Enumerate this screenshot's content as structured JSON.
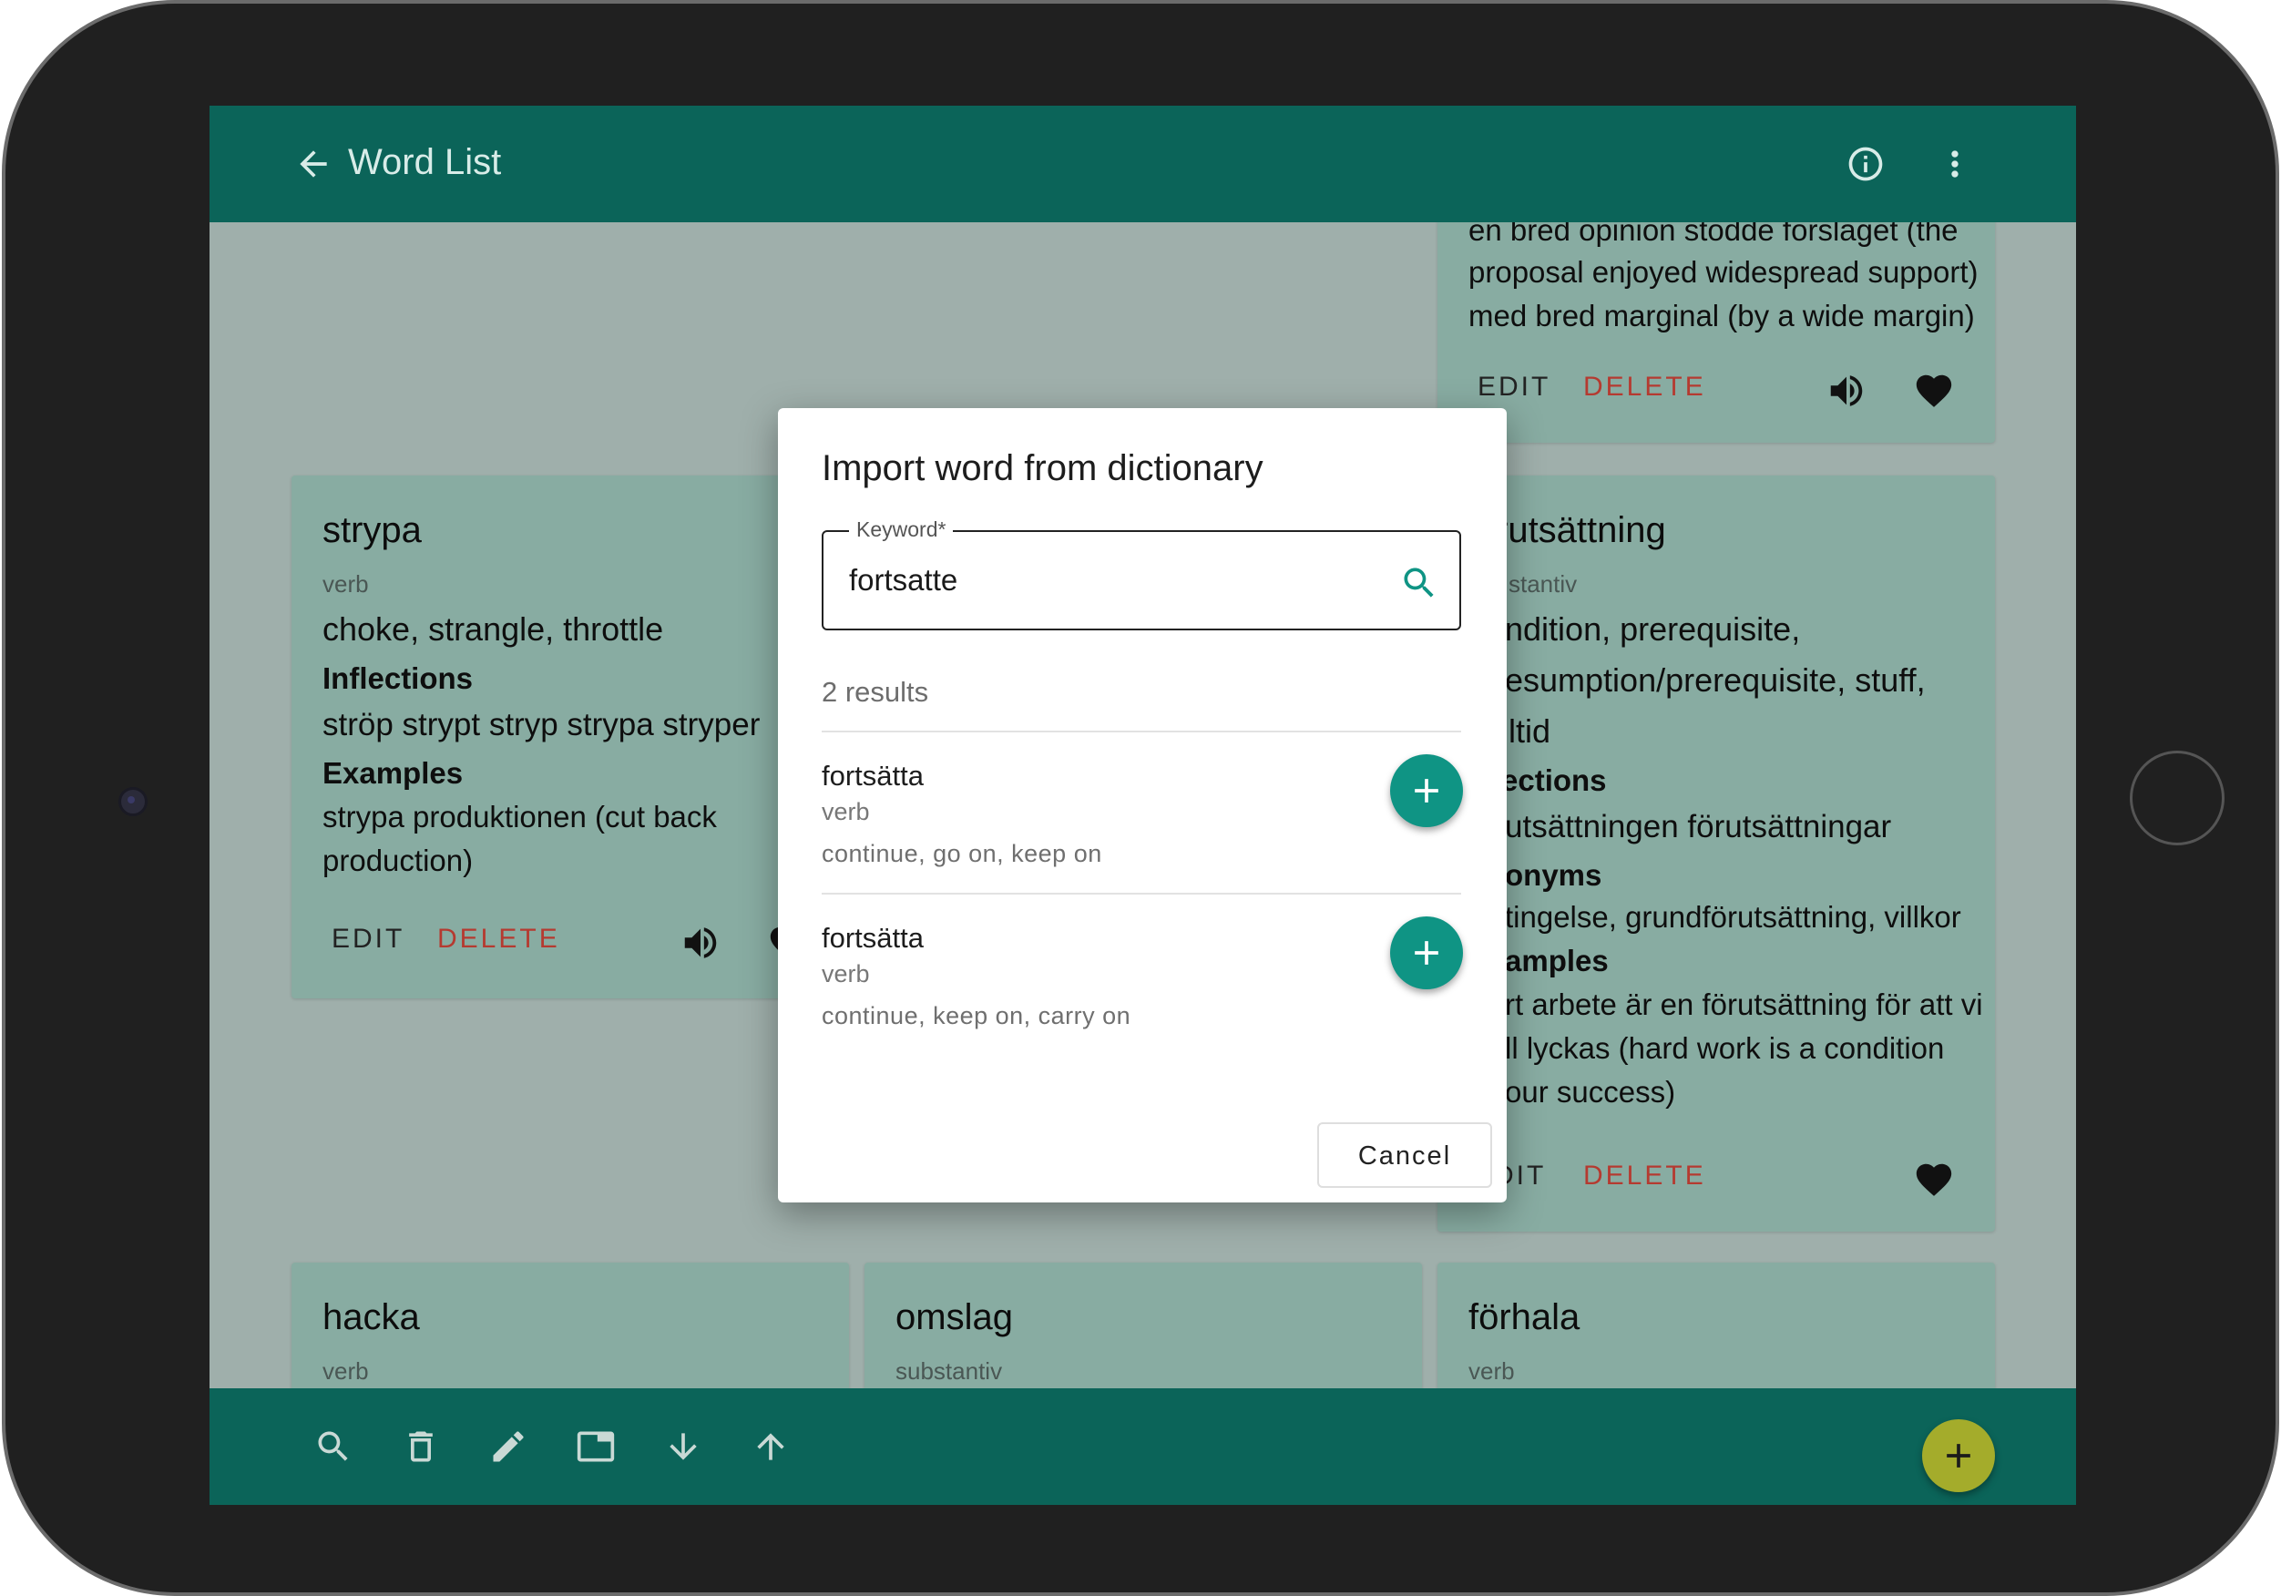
{
  "app": {
    "title": "Word List",
    "back_icon": "arrow-left-icon",
    "info_icon": "info-icon",
    "more_icon": "more-vert-icon",
    "header_color": "#0b6459",
    "fab_color": "#a4ac2b",
    "accent_color": "#0f9484"
  },
  "cards": {
    "top_right": {
      "line0": "en bred opinion stödde förslaget (the",
      "line1": "proposal enjoyed widespread support)",
      "line2": "med bred marginal (by a wide margin)",
      "edit": "EDIT",
      "delete": "DELETE"
    },
    "strypa": {
      "word": "strypa",
      "pos": "verb",
      "translation": "choke, strangle, throttle",
      "inflections_label": "Inflections",
      "inflections": "ströp strypt stryp strypa stryper",
      "examples_label": "Examples",
      "example1": "strypa produktionen (cut back",
      "example2": "production)",
      "edit": "EDIT",
      "delete": "DELETE"
    },
    "forutsattning": {
      "word": "förutsättning",
      "word_visible": "rutsättning",
      "pos_visible": "stantiv",
      "line1": "ndition, prerequisite,",
      "line2": "esumption/prerequisite, stuff,",
      "line3": "ltid",
      "inflections_label": "ections",
      "inflections": "utsättningen förutsättningar",
      "synonyms_label": "onyms",
      "synonyms": "tingelse, grundförutsättning, villkor",
      "examples_label": "amples",
      "example1": "rt arbete är en förutsättning för att vi",
      "example2": "ll lyckas (hard work is a condition",
      "example3": "our success)",
      "edit": "DIT",
      "delete": "DELETE"
    },
    "hacka": {
      "word": "hacka",
      "pos": "verb"
    },
    "omslag": {
      "word": "omslag",
      "pos": "substantiv"
    },
    "forhala": {
      "word": "förhala",
      "pos": "verb"
    }
  },
  "dialog": {
    "title": "Import word from dictionary",
    "keyword_label": "Keyword*",
    "keyword_value": "fortsatte",
    "results_count": "2 results",
    "results": [
      {
        "word": "fortsätta",
        "pos": "verb",
        "definition": "continue, go on, keep on"
      },
      {
        "word": "fortsätta",
        "pos": "verb",
        "definition": "continue, keep on, carry on"
      }
    ],
    "cancel_label": "Cancel"
  },
  "bottom_bar": {
    "icons": [
      "search-icon",
      "delete-icon",
      "edit-icon",
      "tab-icon",
      "arrow-down-icon",
      "arrow-up-icon"
    ],
    "fab_icon": "plus-icon"
  }
}
